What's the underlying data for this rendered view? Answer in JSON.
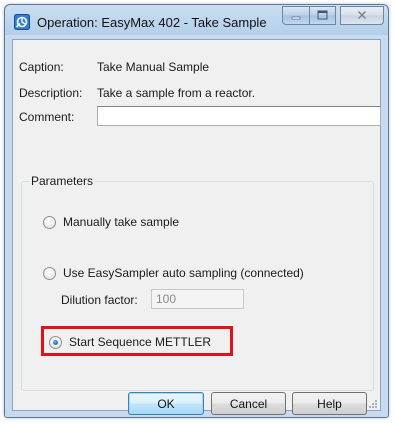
{
  "window": {
    "title": "Operation: EasyMax 402 - Take Sample",
    "icon": "operation-app-icon",
    "controls": {
      "minimize_icon": "minimize-icon",
      "maximize_icon": "maximize-icon",
      "close_icon": "close-icon"
    }
  },
  "form": {
    "caption_label": "Caption:",
    "caption_value": "Take Manual Sample",
    "description_label": "Description:",
    "description_value": "Take a sample from a reactor.",
    "comment_label": "Comment:",
    "comment_value": ""
  },
  "parameters": {
    "title": "Parameters",
    "options": [
      {
        "label": "Manually take sample",
        "checked": false
      },
      {
        "label": "Use EasySampler auto sampling (connected)",
        "checked": false
      },
      {
        "label": "Start Sequence METTLER",
        "checked": true
      }
    ],
    "dilution_label": "Dilution factor:",
    "dilution_value": "100",
    "highlight_color": "#e0111b"
  },
  "buttons": {
    "ok": "OK",
    "cancel": "Cancel",
    "help": "Help"
  }
}
